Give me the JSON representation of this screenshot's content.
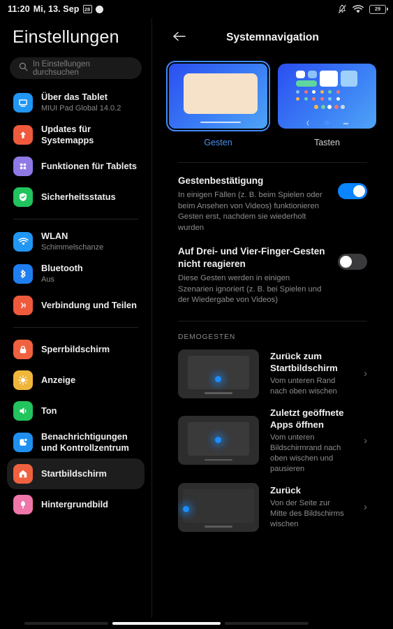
{
  "status_bar": {
    "time": "11:20",
    "date": "Mi, 13. Sep",
    "calendar_day": "28",
    "battery_level": "29",
    "icons": [
      "calendar-icon",
      "circle-icon",
      "bell-mute-icon",
      "wifi-icon",
      "battery-icon"
    ]
  },
  "sidebar": {
    "app_title": "Einstellungen",
    "search": {
      "placeholder": "In Einstellungen durchsuchen",
      "value": ""
    },
    "groups": [
      {
        "items": [
          {
            "label": "Über das Tablet",
            "sub": "MIUI Pad Global 14.0.2",
            "icon": "tablet-icon",
            "color": "#2196f3",
            "active": false
          },
          {
            "label": "Updates für Systemapps",
            "sub": "",
            "icon": "upload-arrow-icon",
            "color": "#f05a3c",
            "active": false
          },
          {
            "label": "Funktionen für Tablets",
            "sub": "",
            "icon": "grid-dots-icon",
            "color": "#8f7ae5",
            "active": false
          },
          {
            "label": "Sicherheitsstatus",
            "sub": "",
            "icon": "shield-check-icon",
            "color": "#21c45d",
            "active": false
          }
        ]
      },
      {
        "items": [
          {
            "label": "WLAN",
            "sub": "Schimmelschanze",
            "icon": "wifi-icon",
            "color": "#2196f3",
            "active": false
          },
          {
            "label": "Bluetooth",
            "sub": "Aus",
            "icon": "bluetooth-icon",
            "color": "#1f7ff0",
            "active": false
          },
          {
            "label": "Verbindung und Teilen",
            "sub": "",
            "icon": "share-icon",
            "color": "#f05a3c",
            "active": false
          }
        ]
      },
      {
        "items": [
          {
            "label": "Sperrbildschirm",
            "sub": "",
            "icon": "lock-icon",
            "color": "#f0613f",
            "active": false
          },
          {
            "label": "Anzeige",
            "sub": "",
            "icon": "brightness-icon",
            "color": "#f0b63c",
            "active": false
          },
          {
            "label": "Ton",
            "sub": "",
            "icon": "speaker-icon",
            "color": "#21c45d",
            "active": false
          },
          {
            "label": "Benachrichtigungen und Kontrollzentrum",
            "sub": "",
            "icon": "notification-icon",
            "color": "#1f8ff0",
            "active": false
          },
          {
            "label": "Startbildschirm",
            "sub": "",
            "icon": "home-icon",
            "color": "#f0613f",
            "active": true
          },
          {
            "label": "Hintergrundbild",
            "sub": "",
            "icon": "flower-icon",
            "color": "#ef76a8",
            "active": false
          }
        ]
      }
    ]
  },
  "main": {
    "title": "Systemnavigation",
    "back_icon": "arrow-left-icon",
    "modes": [
      {
        "label": "Gesten",
        "selected": true,
        "preview": "gesture-preview"
      },
      {
        "label": "Tasten",
        "selected": false,
        "preview": "buttons-preview"
      }
    ],
    "settings": [
      {
        "title": "Gestenbestätigung",
        "desc": "In einigen Fällen (z. B. beim Spielen oder beim Ansehen von Videos) funktionieren Gesten erst, nachdem sie wiederholt wurden",
        "toggle": "on"
      },
      {
        "title": "Auf Drei- und Vier-Finger-Gesten nicht reagieren",
        "desc": "Diese Gesten werden in einigen Szenarien ignoriert (z. B. bei Spielen und der Wiedergabe von Videos)",
        "toggle": "off"
      }
    ],
    "demo_section_header": "DEMOGESTEN",
    "demos": [
      {
        "title": "Zurück zum Startbildschirm",
        "desc": "Vom unteren Rand nach oben wischen",
        "chevron": "chevron-right-icon"
      },
      {
        "title": "Zuletzt geöffnete Apps öffnen",
        "desc": "Vom unteren Bildschirmrand nach oben wischen und pausieren",
        "chevron": "chevron-right-icon"
      },
      {
        "title": "Zurück",
        "desc": "Von der Seite zur Mitte des Bildschirms wischen",
        "chevron": "chevron-right-icon"
      }
    ]
  },
  "colors": {
    "accent": "#0a84ff",
    "selected_mode": "#4f8ff0",
    "background": "#000000",
    "card_blue": "#3a7df5"
  }
}
